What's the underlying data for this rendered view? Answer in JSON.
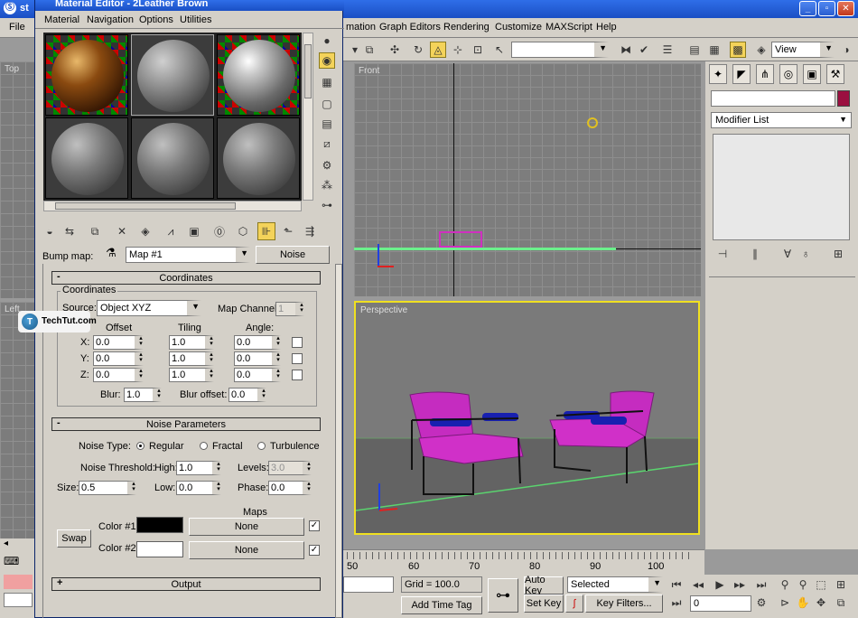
{
  "max_window": {
    "title_fragment": "st",
    "menu": [
      "File",
      "mation",
      "Graph Editors",
      "Rendering",
      "Customize",
      "MAXScript",
      "Help"
    ],
    "view_combo": "View",
    "viewports": {
      "top": "Top",
      "left": "Left",
      "front": "Front",
      "perspective": "Perspective"
    }
  },
  "command_panel": {
    "modifier_list": "Modifier List",
    "object_color": "#9b1040"
  },
  "timeline": {
    "ticks": [
      "50",
      "60",
      "70",
      "80",
      "90",
      "100"
    ]
  },
  "status_bar": {
    "grid": "Grid = 100.0",
    "auto_key": "Auto Key",
    "selected_combo": "Selected",
    "set_key": "Set Key",
    "key_filters": "Key Filters...",
    "add_time_tag": "Add Time Tag",
    "frame": "0"
  },
  "material_editor": {
    "title": "Material Editor - 2Leather Brown",
    "menu": [
      "Material",
      "Navigation",
      "Options",
      "Utilities"
    ],
    "bump_map_label": "Bump map:",
    "map_name": "Map #1",
    "map_type": "Noise",
    "coordinates": {
      "rollout_title": "Coordinates",
      "group_title": "Coordinates",
      "source_label": "Source:",
      "source_value": "Object XYZ",
      "map_channel_label": "Map Channel:",
      "map_channel_value": "1",
      "col_offset": "Offset",
      "col_tiling": "Tiling",
      "col_angle": "Angle:",
      "rows": [
        {
          "axis": "X:",
          "offset": "0.0",
          "tiling": "1.0",
          "angle": "0.0"
        },
        {
          "axis": "Y:",
          "offset": "0.0",
          "tiling": "1.0",
          "angle": "0.0"
        },
        {
          "axis": "Z:",
          "offset": "0.0",
          "tiling": "1.0",
          "angle": "0.0"
        }
      ],
      "blur_label": "Blur:",
      "blur_value": "1.0",
      "blur_offset_label": "Blur offset:",
      "blur_offset_value": "0.0"
    },
    "noise": {
      "rollout_title": "Noise Parameters",
      "noise_type_label": "Noise Type:",
      "type_regular": "Regular",
      "type_fractal": "Fractal",
      "type_turbulence": "Turbulence",
      "selected_type": "Regular",
      "threshold_label": "Noise Threshold:",
      "high_label": "High:",
      "high_value": "1.0",
      "levels_label": "Levels:",
      "levels_value": "3.0",
      "size_label": "Size:",
      "size_value": "0.5",
      "low_label": "Low:",
      "low_value": "0.0",
      "phase_label": "Phase:",
      "phase_value": "0.0",
      "maps_label": "Maps",
      "swap_label": "Swap",
      "color1_label": "Color #1",
      "color1": "#000000",
      "color1_map": "None",
      "color2_label": "Color #2",
      "color2": "#ffffff",
      "color2_map": "None"
    },
    "output_title": "Output"
  },
  "watermark": {
    "text": "TechTut.com"
  }
}
